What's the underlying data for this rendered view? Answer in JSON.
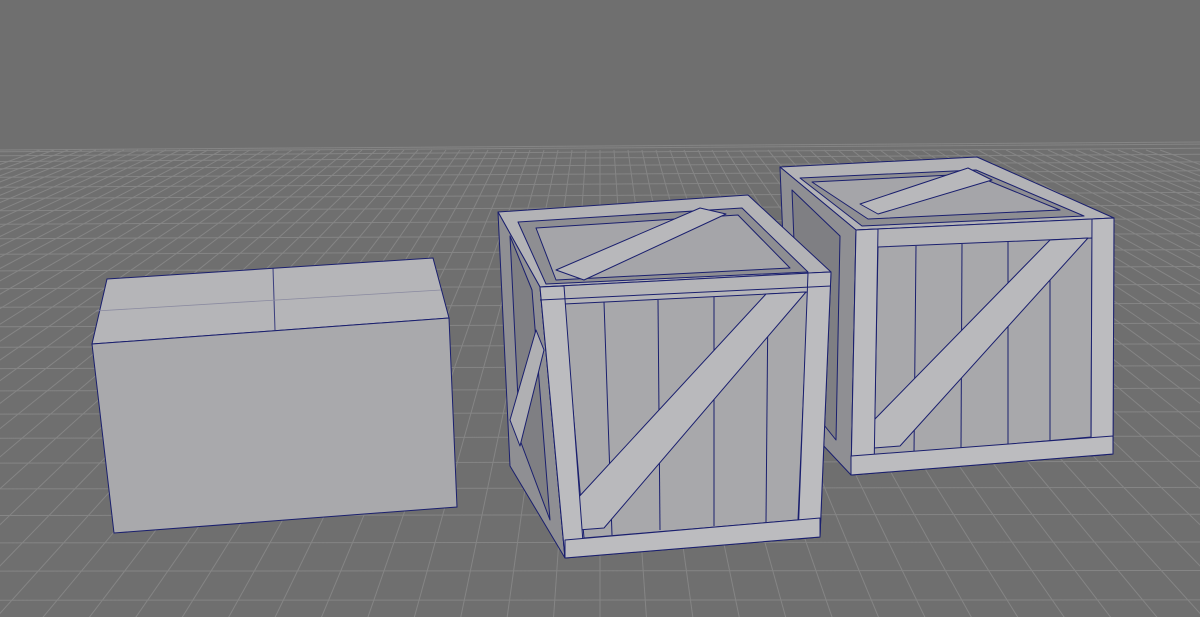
{
  "viewport": {
    "background_color": "#6f6f6f",
    "grid_color": "#858585",
    "mesh_fill": "#a9a9ac",
    "mesh_fill_dark": "#8c8c90",
    "mesh_fill_light": "#b8b8bb",
    "edge_color": "#1a1f6e",
    "grid_visible": true
  },
  "objects": [
    {
      "name": "box-block",
      "shading": "smooth"
    },
    {
      "name": "crate-1",
      "shading": "smooth"
    },
    {
      "name": "crate-2",
      "shading": "smooth"
    }
  ]
}
